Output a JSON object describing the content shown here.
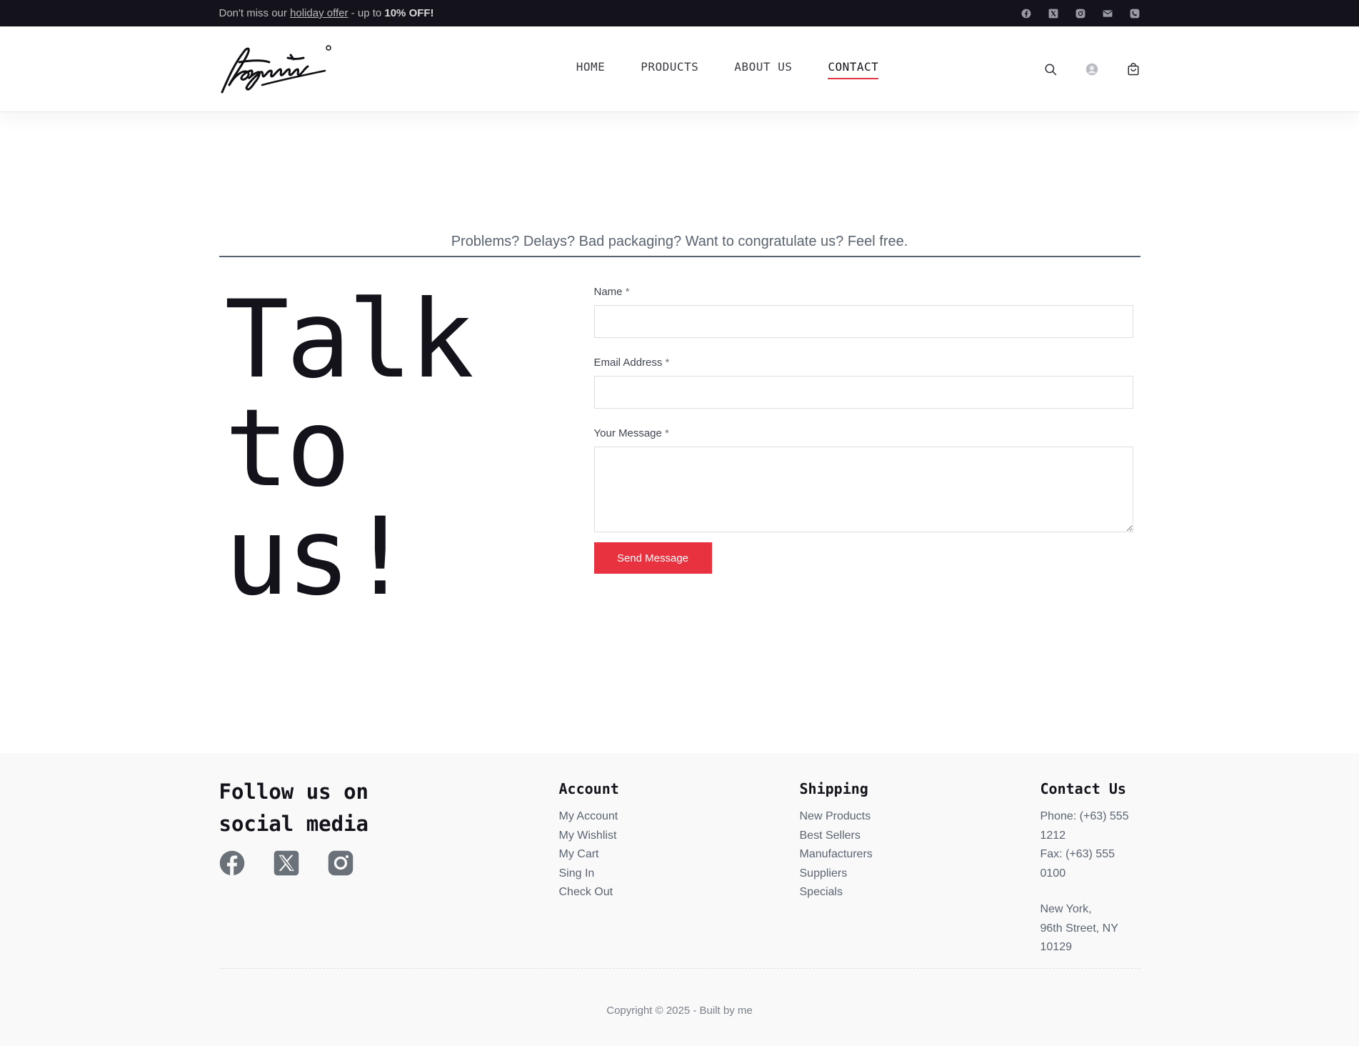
{
  "topbar": {
    "promo_prefix": "Don't miss our ",
    "promo_link": "holiday offer",
    "promo_mid": " - up to ",
    "promo_bold": "10% OFF!",
    "icons": [
      "facebook-icon",
      "x-icon",
      "instagram-icon",
      "mail-icon",
      "phone-icon"
    ]
  },
  "header": {
    "nav": [
      "HOME",
      "PRODUCTS",
      "ABOUT US",
      "CONTACT"
    ],
    "active_nav": "CONTACT",
    "icons": [
      "search-icon",
      "user-icon",
      "cart-icon"
    ]
  },
  "main": {
    "tagline": "Problems? Delays? Bad packaging? Want to congratulate us? Feel free.",
    "heading_lines": [
      "Talk",
      "to",
      "us!"
    ],
    "form": {
      "name_label": "Name",
      "email_label": "Email Address",
      "message_label": "Your Message",
      "required_mark": "*",
      "submit_label": "Send Message"
    }
  },
  "footer": {
    "social_heading_line1": "Follow us on",
    "social_heading_line2": "social media",
    "account": {
      "title": "Account",
      "items": [
        "My Account",
        "My Wishlist",
        "My Cart",
        "Sing In",
        "Check Out"
      ]
    },
    "shipping": {
      "title": "Shipping",
      "items": [
        "New Products",
        "Best Sellers",
        "Manufacturers",
        "Suppliers",
        "Specials"
      ]
    },
    "contact": {
      "title": "Contact Us",
      "phone": "Phone: (+63) 555 1212",
      "fax": "Fax: (+63) 555 0100",
      "address_line1": "New York,",
      "address_line2": "96th Street, NY 10129"
    },
    "copyright": "Copyright © 2025 - Built by me"
  },
  "colors": {
    "topbar_bg": "#14131b",
    "accent": "#e8323f",
    "text_muted": "#5a6470"
  }
}
